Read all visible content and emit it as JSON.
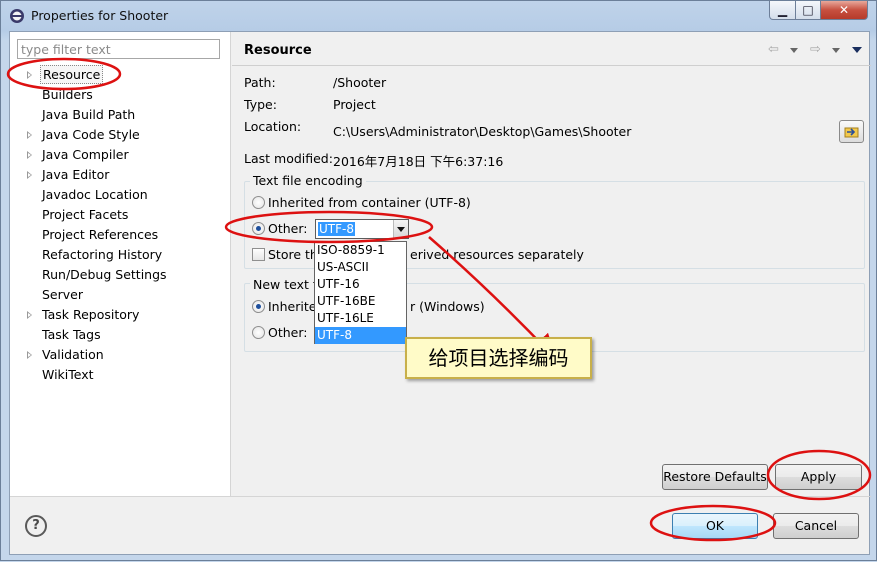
{
  "window": {
    "title": "Properties for Shooter",
    "minimize_glyph": "▁",
    "maximize_glyph": "□",
    "close_glyph": "✕",
    "close_color": "#c75040"
  },
  "sidebar": {
    "filter_placeholder": "type filter text",
    "items": [
      {
        "label": "Resource",
        "expandable": true,
        "selected": true
      },
      {
        "label": "Builders",
        "expandable": false
      },
      {
        "label": "Java Build Path",
        "expandable": false
      },
      {
        "label": "Java Code Style",
        "expandable": true
      },
      {
        "label": "Java Compiler",
        "expandable": true
      },
      {
        "label": "Java Editor",
        "expandable": true
      },
      {
        "label": "Javadoc Location",
        "expandable": false
      },
      {
        "label": "Project Facets",
        "expandable": false
      },
      {
        "label": "Project References",
        "expandable": false
      },
      {
        "label": "Refactoring History",
        "expandable": false
      },
      {
        "label": "Run/Debug Settings",
        "expandable": false
      },
      {
        "label": "Server",
        "expandable": false
      },
      {
        "label": "Task Repository",
        "expandable": true
      },
      {
        "label": "Task Tags",
        "expandable": false
      },
      {
        "label": "Validation",
        "expandable": true
      },
      {
        "label": "WikiText",
        "expandable": false
      }
    ]
  },
  "header": {
    "title": "Resource",
    "nav_icons": [
      "back-arrow-icon",
      "forward-arrow-icon",
      "view-menu-icon"
    ]
  },
  "info": {
    "path_label": "Path:",
    "path_value": "/Shooter",
    "type_label": "Type:",
    "type_value": "Project",
    "location_label": "Location:",
    "location_value": "C:\\Users\\Administrator\\Desktop\\Games\\Shooter",
    "location_icon": "show-in-explorer-icon",
    "modified_label": "Last modified:",
    "modified_value": "2016年7月18日 下午6:37:16"
  },
  "encoding": {
    "group_title": "Text file encoding",
    "inherited_label": "Inherited from container (UTF-8)",
    "other_label": "Other:",
    "selected_value": "UTF-8",
    "options": [
      "ISO-8859-1",
      "US-ASCII",
      "UTF-16",
      "UTF-16BE",
      "UTF-16LE",
      "UTF-8"
    ],
    "store_prefix": "Store th",
    "store_suffix": "erived resources separately"
  },
  "line_delimiter": {
    "group_title_prefix": "New text fi",
    "inherited_prefix": "Inherite",
    "inherited_suffix": "r (Windows)",
    "other_label": "Other:"
  },
  "buttons": {
    "restore_defaults": "Restore Defaults",
    "apply": "Apply",
    "ok": "OK",
    "cancel": "Cancel",
    "help": "?"
  },
  "annotation": {
    "callout_text": "给项目选择编码",
    "highlight_color": "#dd1111"
  }
}
